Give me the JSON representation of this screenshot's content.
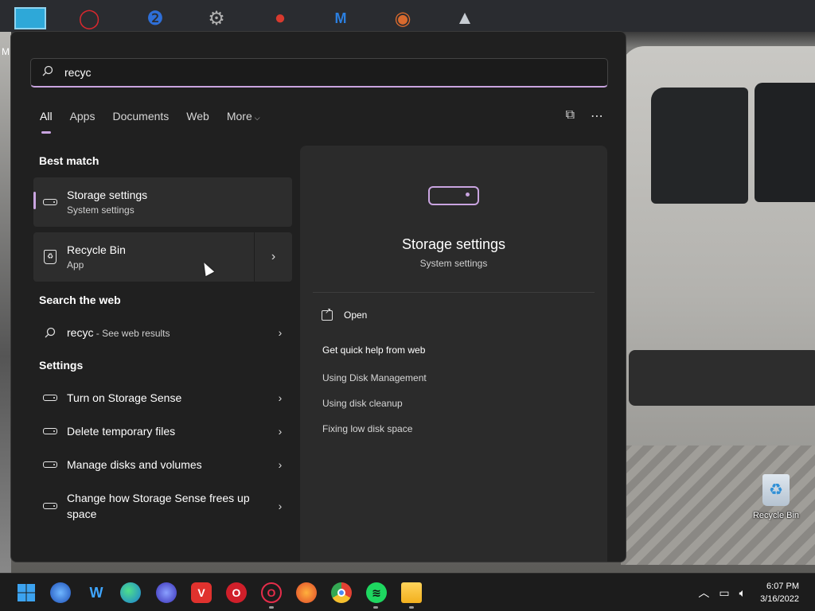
{
  "desktop": {
    "edge_letter": "M",
    "top_icons": [
      "opera-icon",
      "app-icon",
      "gear-app-icon",
      "bird-icon",
      "mp-game-icon",
      "pizza-icon",
      "shark-icon"
    ],
    "recycle_bin_label": "Recycle Bin"
  },
  "search": {
    "query": "recyc",
    "tabs": [
      {
        "label": "All"
      },
      {
        "label": "Apps"
      },
      {
        "label": "Documents"
      },
      {
        "label": "Web"
      },
      {
        "label": "More"
      }
    ]
  },
  "best_match": {
    "heading": "Best match",
    "items": [
      {
        "title": "Storage settings",
        "subtitle": "System settings"
      },
      {
        "title": "Recycle Bin",
        "subtitle": "App"
      }
    ]
  },
  "web": {
    "heading": "Search the web",
    "query": "recyc",
    "hint": " - See web results"
  },
  "settings": {
    "heading": "Settings",
    "items": [
      {
        "label": "Turn on Storage Sense"
      },
      {
        "label": "Delete temporary files"
      },
      {
        "label": "Manage disks and volumes"
      },
      {
        "label": "Change how Storage Sense frees up space"
      }
    ]
  },
  "preview": {
    "title": "Storage settings",
    "subtitle": "System settings",
    "open_label": "Open",
    "help_title": "Get quick help from web",
    "help_links": [
      "Using Disk Management",
      "Using disk cleanup",
      "Fixing low disk space"
    ]
  },
  "taskbar": {
    "apps": [
      "windows-start",
      "firefox",
      "wing",
      "edge",
      "firefox-dev",
      "vivaldi",
      "opera",
      "opera-gx",
      "firefox-nightly",
      "chrome",
      "spotify",
      "file-explorer"
    ],
    "time": "6:07 PM",
    "date": "3/16/2022"
  },
  "colors": {
    "accent": "#c9a4e0",
    "panel_bg": "#202020",
    "card_bg": "#2d2d2d",
    "taskbar_bg": "#1c1c1c"
  }
}
